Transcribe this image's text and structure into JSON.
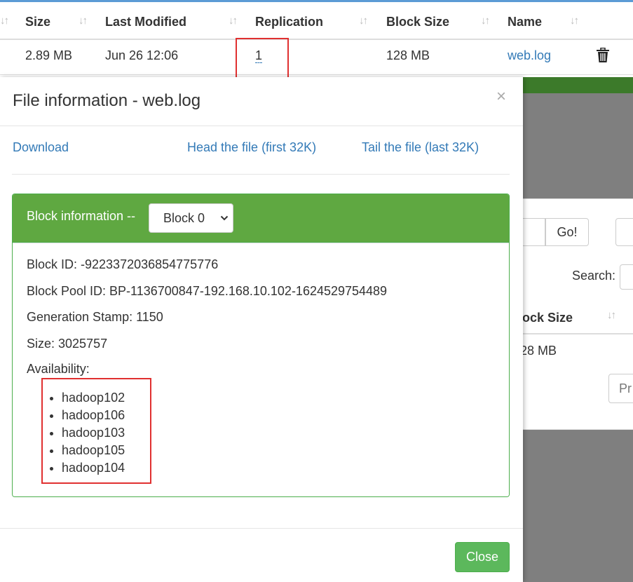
{
  "background_table": {
    "headers": [
      "Size",
      "Last Modified",
      "Replication",
      "Block Size",
      "Name"
    ],
    "row": {
      "size": "2.89 MB",
      "last_modified": "Jun 26 12:06",
      "replication": "1",
      "block_size": "128 MB",
      "name": "web.log"
    }
  },
  "background_overlay": {
    "go_label": "Go!",
    "search_label": "Search:",
    "block_size_header": "lock Size",
    "block_size_value": "28 MB",
    "pager_btn": "Pr"
  },
  "modal": {
    "title": "File information - web.log",
    "close_symbol": "×",
    "links": {
      "download": "Download",
      "head": "Head the file (first 32K)",
      "tail": "Tail the file (last 32K)"
    },
    "block_panel": {
      "title": "Block information --",
      "selected_block": "Block 0",
      "block_id": "Block ID: -9223372036854775776",
      "block_pool_id": "Block Pool ID: BP-1136700847-192.168.10.102-1624529754489",
      "generation_stamp": "Generation Stamp: 1150",
      "size": "Size: 3025757",
      "availability_label": "Availability:",
      "availability": [
        "hadoop102",
        "hadoop106",
        "hadoop103",
        "hadoop105",
        "hadoop104"
      ]
    },
    "close_button": "Close"
  },
  "colors": {
    "panel_header": "#5fa841",
    "link": "#337ab7",
    "highlight_box": "#e03030",
    "close_button": "#5cb85c"
  }
}
